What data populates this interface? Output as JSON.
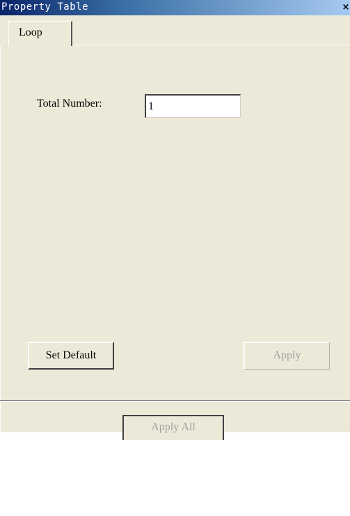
{
  "window": {
    "title": "Property Table",
    "close_glyph": "×"
  },
  "tabs": [
    {
      "label": "Loop",
      "selected": true
    }
  ],
  "form": {
    "total_number_label": "Total Number:",
    "total_number_value": "1"
  },
  "buttons": {
    "set_default": "Set Default",
    "apply": "Apply",
    "apply_all": "Apply All"
  },
  "state": {
    "apply_enabled": false,
    "apply_all_enabled": false
  }
}
